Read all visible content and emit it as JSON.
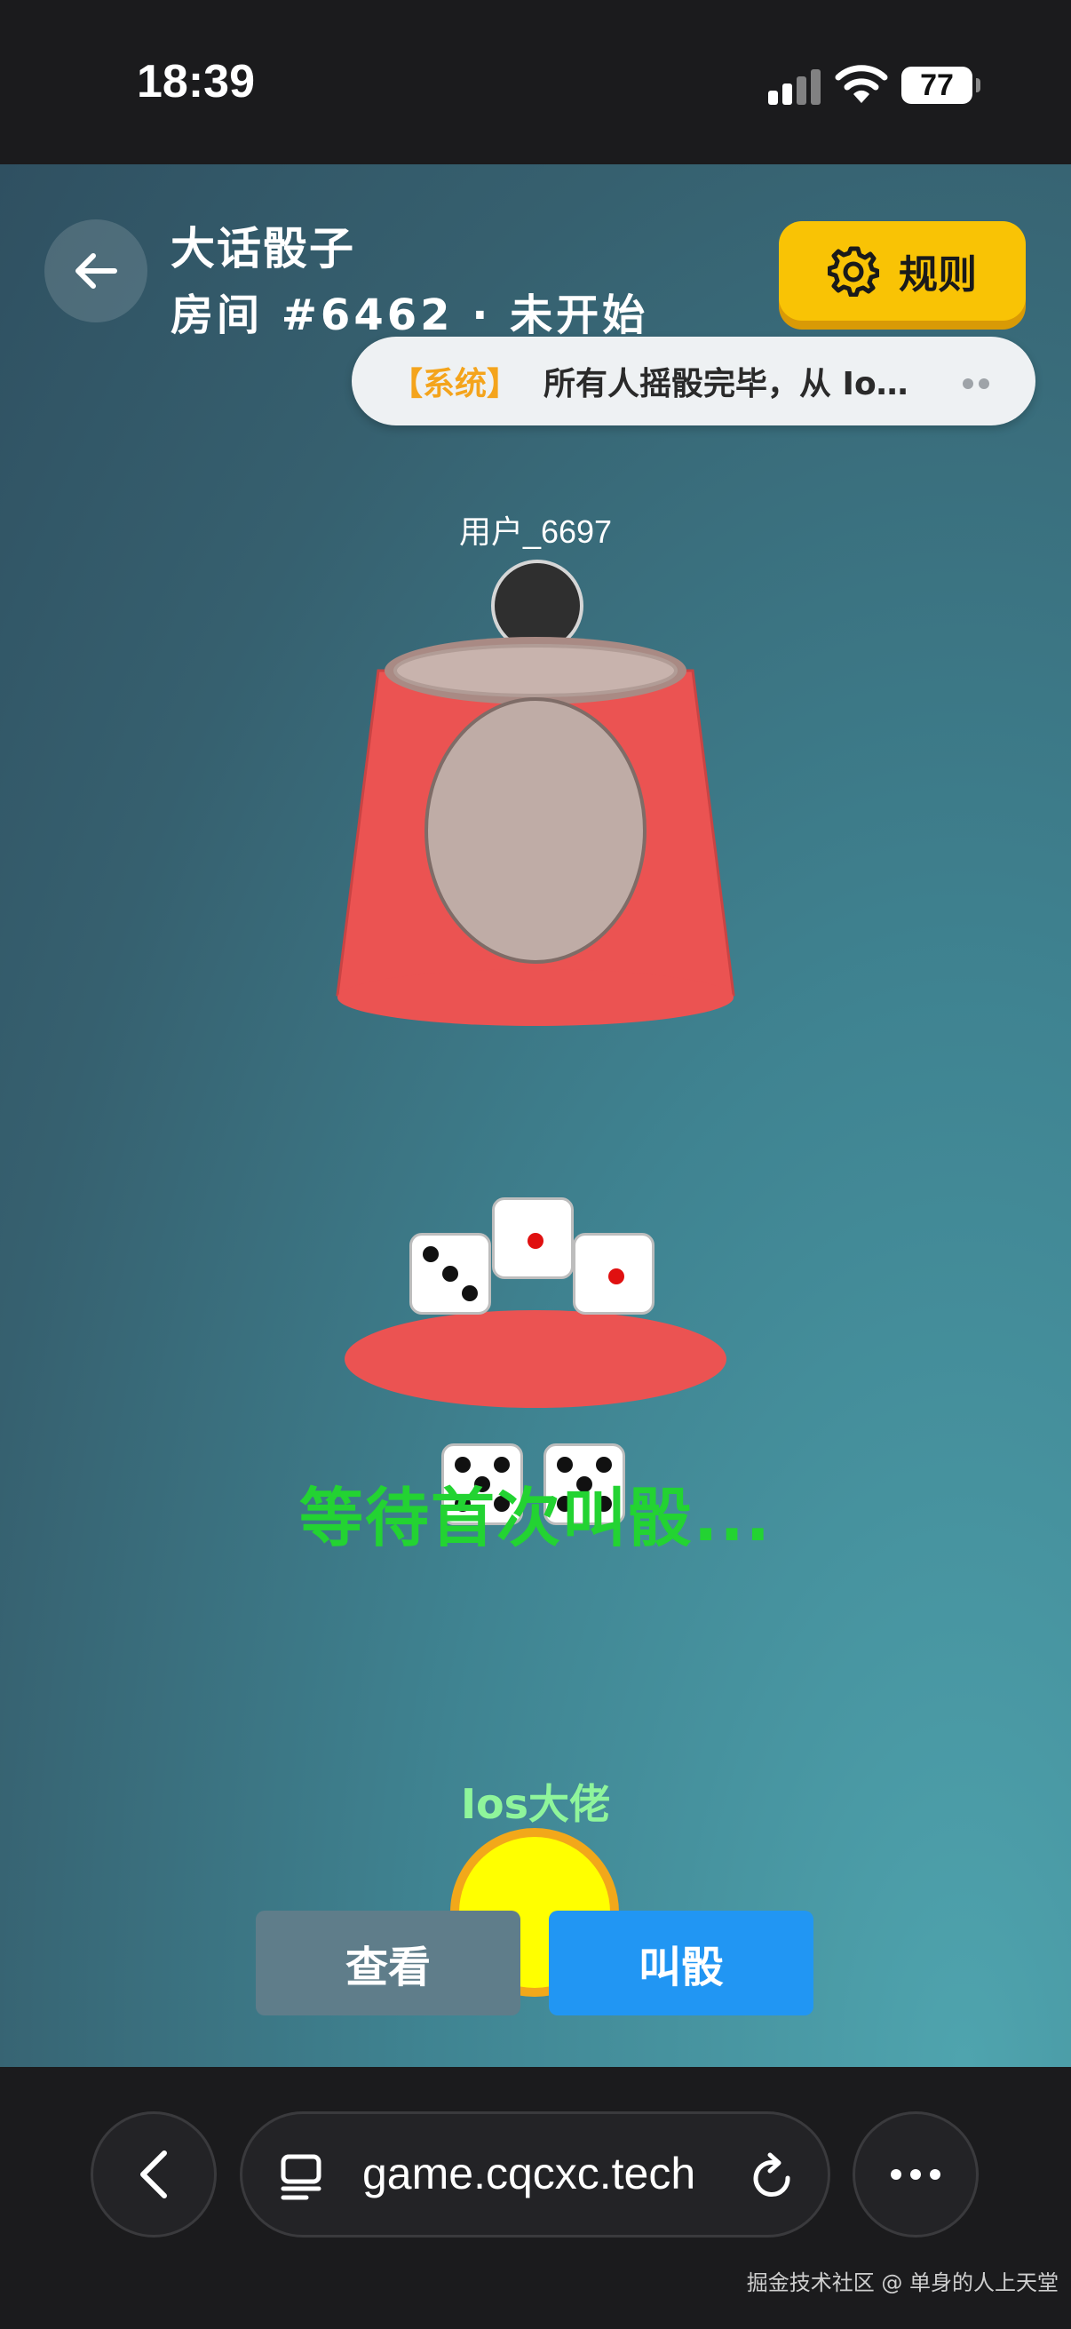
{
  "status_bar": {
    "time": "18:39",
    "battery": "77"
  },
  "header": {
    "title": "大话骰子",
    "subtitle": "房间 #6462 · 未开始",
    "rules_label": "规则"
  },
  "notice": {
    "tag": "【系统】",
    "text": "所有人摇骰完毕，从 Io…"
  },
  "opponent": {
    "name": "用户_6697"
  },
  "status_message": "等待首次叫骰...",
  "dice": [
    {
      "value": 3
    },
    {
      "value": 1
    },
    {
      "value": 1
    },
    {
      "value": 5
    },
    {
      "value": 5
    }
  ],
  "me": {
    "name": "Ios大佬"
  },
  "actions": {
    "view_label": "查看",
    "bid_label": "叫骰"
  },
  "browser": {
    "url": "game.cqcxc.tech"
  },
  "watermark": "掘金技术社区 @ 单身的人上天堂",
  "colors": {
    "cup_red": "#eb5352",
    "rules_yellow": "#f9c305",
    "waiting_green": "#23d332",
    "bid_blue": "#2196f3",
    "view_gray": "#5f7d8a"
  }
}
